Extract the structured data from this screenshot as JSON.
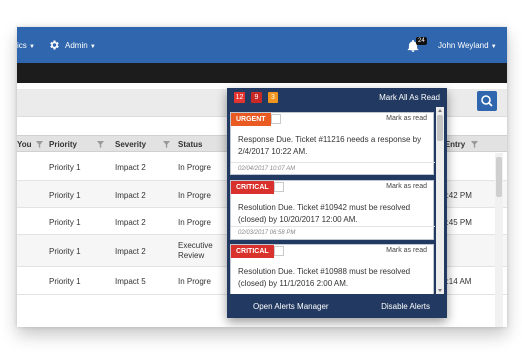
{
  "topbar": {
    "nav_fragment": "ics",
    "admin_label": "Admin",
    "notification_count": "24",
    "user_name": "John Weyland"
  },
  "grid": {
    "columns": {
      "you": "You",
      "priority": "Priority",
      "severity": "Severity",
      "status": "Status",
      "entry": "nal Entry"
    },
    "rows": [
      {
        "priority": "Priority 1",
        "severity": "Impact 2",
        "status": "In Progre",
        "entry": ""
      },
      {
        "priority": "Priority 1",
        "severity": "Impact 2",
        "status": "In Progre",
        "entry": "5 04:42 PM"
      },
      {
        "priority": "Priority 1",
        "severity": "Impact 2",
        "status": "In Progre",
        "entry": "6 01:45 PM"
      },
      {
        "priority": "Priority 1",
        "severity": "Impact 2",
        "status": "Executive Review",
        "entry": ""
      },
      {
        "priority": "Priority 1",
        "severity": "Impact 5",
        "status": "In Progre",
        "entry": "5 09:14 AM"
      }
    ]
  },
  "alerts_panel": {
    "counts": {
      "red": "12",
      "dark_red": "9",
      "orange": "3"
    },
    "mark_all_label": "Mark All As Read",
    "items": [
      {
        "tag": "URGENT",
        "tag_color": "#ea5a23",
        "mark_label": "Mark as read",
        "message": "Response Due. Ticket #11216 needs a response by 2/4/2017 10:22 AM.",
        "timestamp": "02/04/2017 10:07 AM"
      },
      {
        "tag": "CRITICAL",
        "tag_color": "#d9312b",
        "mark_label": "Mark as read",
        "message": "Resolution Due. Ticket #10942 must be resolved (closed) by 10/20/2017 12:00 AM.",
        "timestamp": "02/03/2017 06:58 PM"
      },
      {
        "tag": "CRITICAL",
        "tag_color": "#d9312b",
        "mark_label": "Mark as read",
        "message": "Resolution Due. Ticket #10988 must be resolved (closed) by 11/1/2016 2:00 AM.",
        "timestamp": ""
      }
    ],
    "open_manager_label": "Open Alerts Manager",
    "disable_label": "Disable Alerts"
  },
  "colors": {
    "topbar": "#2f66ad",
    "panel": "#223a61",
    "badge_red": "#e3342f",
    "badge_dark_red": "#c72a26",
    "badge_orange": "#f0961e"
  }
}
